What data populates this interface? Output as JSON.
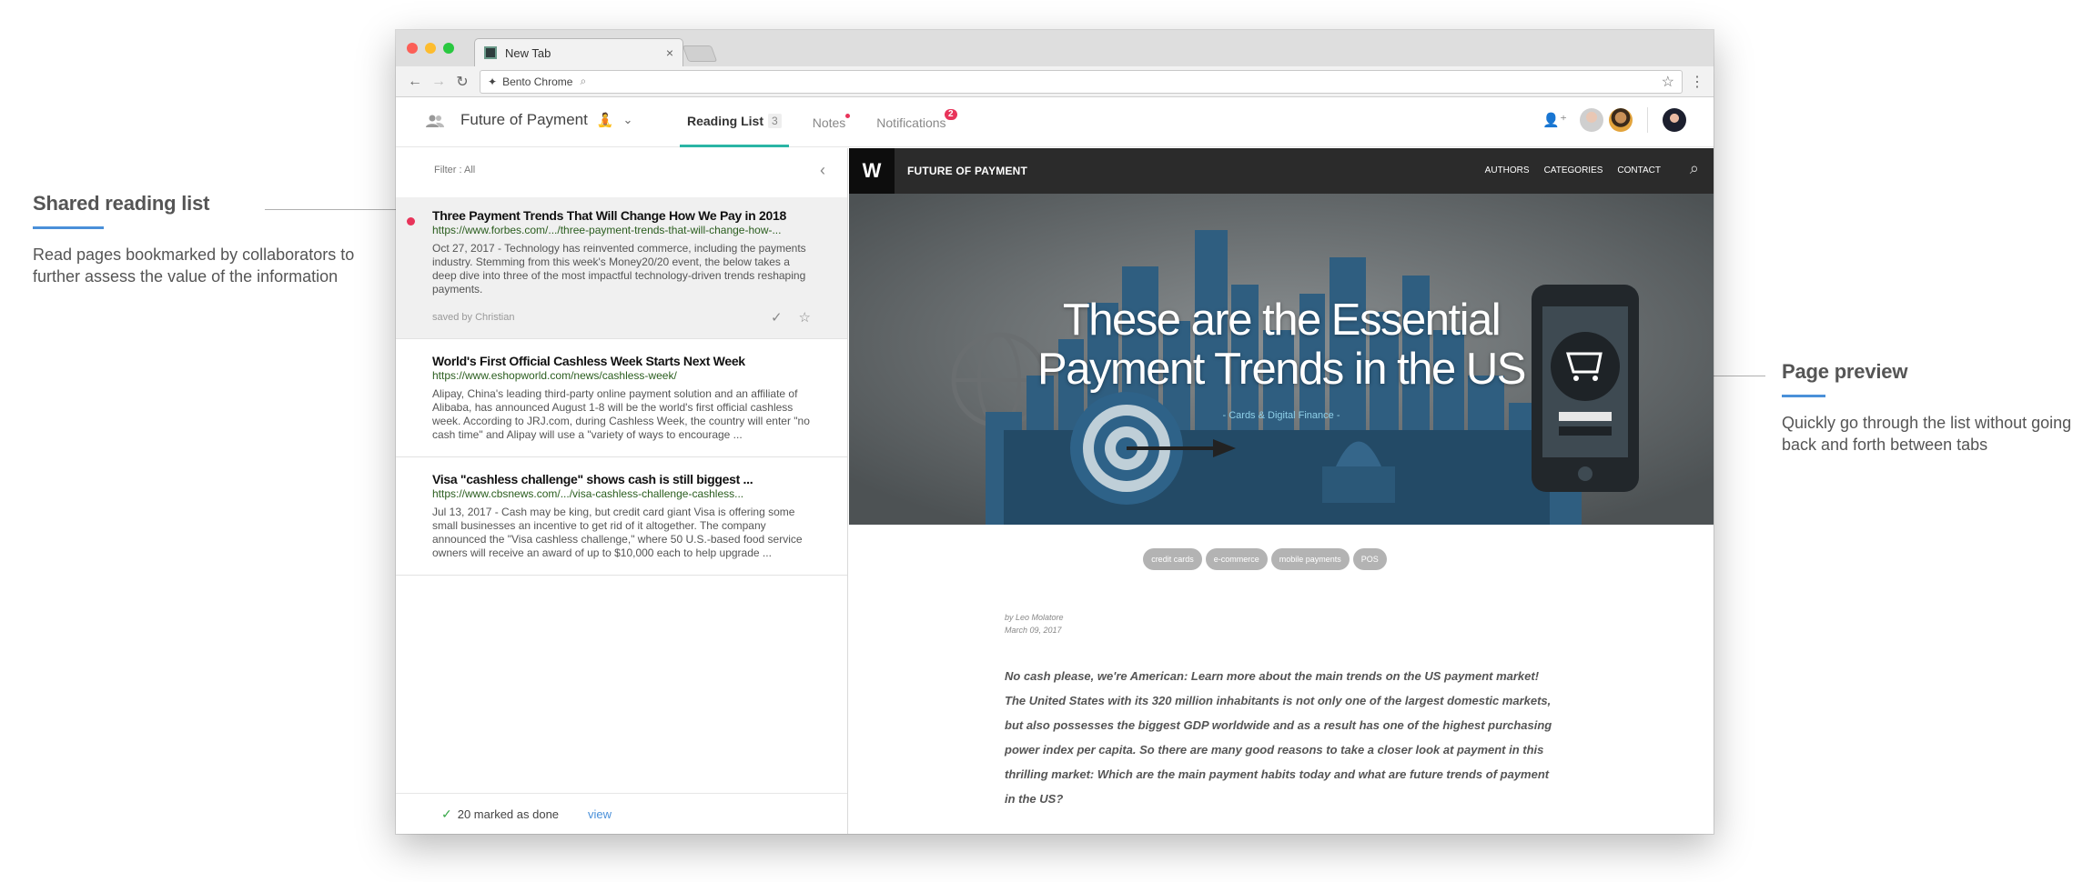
{
  "annotations": {
    "left": {
      "title": "Shared reading list",
      "text": "Read pages bookmarked by collaborators to further assess the value of the information"
    },
    "right": {
      "title": "Page preview",
      "text": "Quickly go through the list without going back and forth between tabs"
    },
    "accent_color": "#4a90d9"
  },
  "browser": {
    "tab_title": "New Tab",
    "address": "Bento Chrome",
    "icons": {
      "back": "arrow-left",
      "forward": "arrow-right",
      "reload": "reload",
      "bookmark": "star",
      "menu": "kebab"
    }
  },
  "app": {
    "project_name": "Future of Payment",
    "project_emoji": "🧘",
    "tabs": [
      {
        "label": "Reading List",
        "count": "3",
        "active": true
      },
      {
        "label": "Notes",
        "indicator": "dot"
      },
      {
        "label": "Notifications",
        "badge": "2"
      }
    ],
    "accent_color": "#2bb5a5",
    "alert_color": "#e8345a"
  },
  "reading_list": {
    "filter": "Filter : All",
    "items": [
      {
        "title": "Three Payment Trends That Will Change How We Pay in 2018",
        "url": "https://www.forbes.com/.../three-payment-trends-that-will-change-how-...",
        "desc": "Oct 27, 2017 - Technology has reinvented commerce, including the payments industry. Stemming from this week's Money20/20 event, the below takes a deep dive into three of the most impactful technology-driven trends reshaping payments.",
        "saved_by": "saved by Christian",
        "unread": true,
        "selected": true
      },
      {
        "title": "World's First Official Cashless Week Starts Next Week",
        "url": "https://www.eshopworld.com/news/cashless-week/",
        "desc": "Alipay, China's leading third-party online payment solution and an affiliate of Alibaba, has announced August 1-8 will be the world's first official cashless week. According to JRJ.com, during Cashless Week, the country will enter \"no cash time\" and Alipay will use a \"variety of ways to encourage ..."
      },
      {
        "title": "Visa \"cashless challenge\" shows cash is still biggest ...",
        "url": "https://www.cbsnews.com/.../visa-cashless-challenge-cashless...",
        "desc": "Jul 13, 2017 - Cash may be king, but credit card giant Visa is offering some small businesses an incentive to get rid of it altogether. The company announced the \"Visa cashless challenge,\" where 50 U.S.-based food service owners will receive an award of up to $10,000 each to help upgrade ..."
      }
    ],
    "footer": {
      "done_text": "20 marked as done",
      "view_link": "view"
    }
  },
  "preview": {
    "site_logo": "W",
    "site_name": "FUTURE OF PAYMENT",
    "nav_links": [
      "AUTHORS",
      "CATEGORIES",
      "CONTACT"
    ],
    "hero_title_line1": "These are the Essential",
    "hero_title_line2": "Payment Trends in the US",
    "hero_subtitle": "- Cards & Digital Finance -",
    "tags": [
      "credit cards",
      "e-commerce",
      "mobile payments",
      "POS"
    ],
    "author": "by Leo Molatore",
    "date": "March 09, 2017",
    "lead": "No cash please, we're American: Learn more about the main trends on the US payment market! The United States with its 320 million inhabitants is not only one of the largest domestic markets, but also possesses the biggest GDP worldwide and as a result has one of the highest purchasing power index per capita. So there are many good reasons to take a closer look at payment in this thrilling market: Which are the main payment habits today and what are future trends of payment in the US?"
  }
}
